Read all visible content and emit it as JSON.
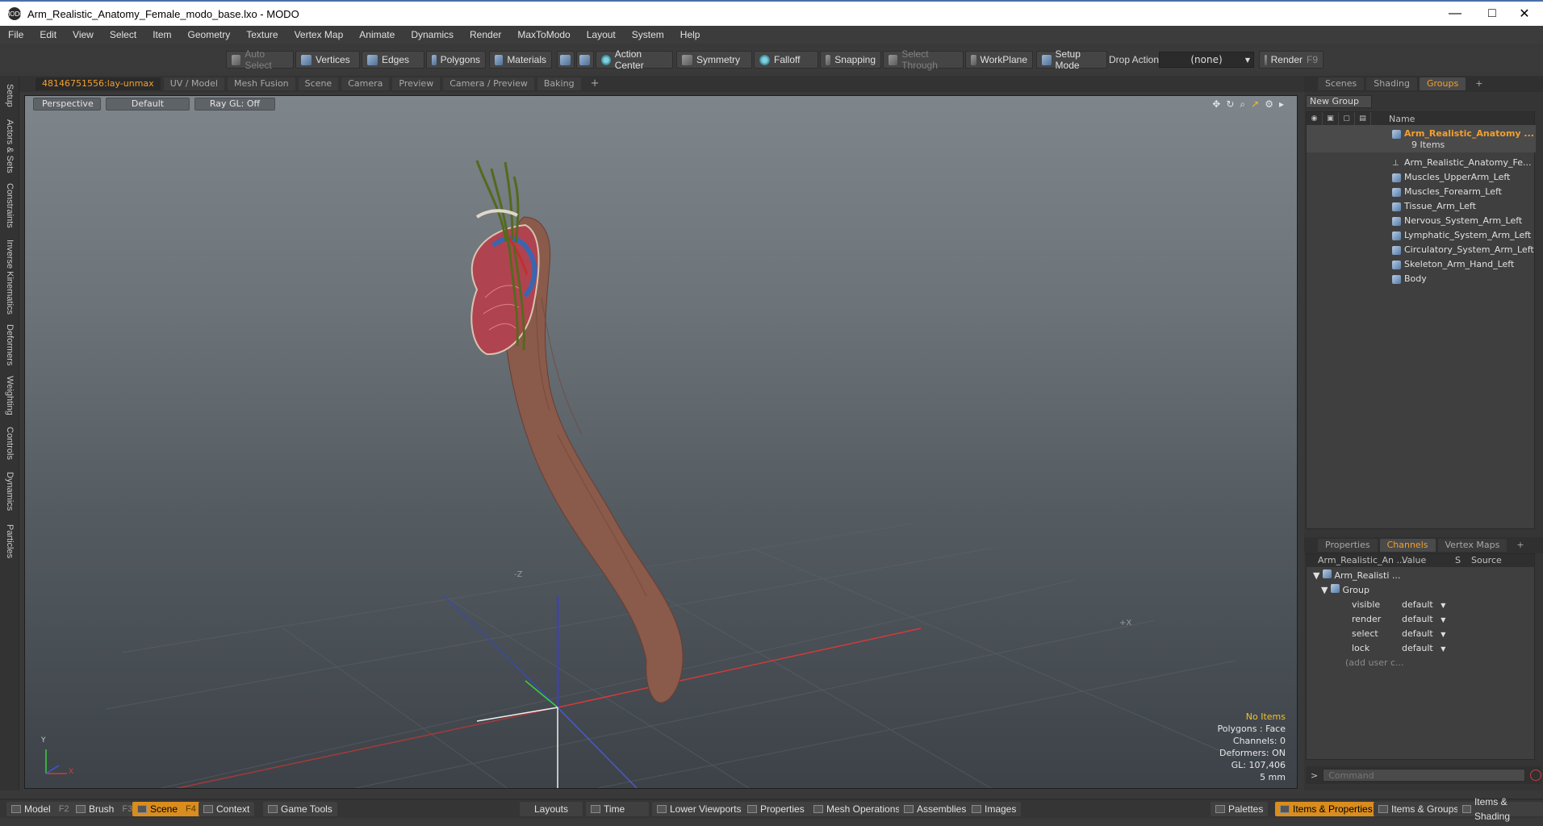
{
  "window": {
    "title": "Arm_Realistic_Anatomy_Female_modo_base.lxo - MODO",
    "app_icon": "MODO"
  },
  "menu": [
    "File",
    "Edit",
    "View",
    "Select",
    "Item",
    "Geometry",
    "Texture",
    "Vertex Map",
    "Animate",
    "Dynamics",
    "Render",
    "MaxToModo",
    "Layout",
    "System",
    "Help"
  ],
  "toolbar": {
    "auto_select": "Auto Select",
    "vertices": "Vertices",
    "edges": "Edges",
    "polygons": "Polygons",
    "materials": "Materials",
    "action_center": "Action Center",
    "symmetry": "Symmetry",
    "falloff": "Falloff",
    "snapping": "Snapping",
    "select_through": "Select Through",
    "workplane": "WorkPlane",
    "setup_mode": "Setup Mode",
    "drop_action": "Drop Action",
    "drop_value": "(none)",
    "render": "Render",
    "render_key": "F9"
  },
  "left_tabs": [
    "Setup",
    "Actors & Sets",
    "Constraints",
    "Inverse Kinematics",
    "Deformers",
    "Weighting",
    "Controls",
    "Dynamics",
    "Particles"
  ],
  "viewport_tabs": [
    "48146751556:lay-unmax",
    "UV / Model",
    "Mesh Fusion",
    "Scene",
    "Camera",
    "Preview",
    "Camera / Preview",
    "Baking"
  ],
  "viewport": {
    "perspective": "Perspective",
    "default": "Default",
    "raygl": "Ray GL: Off",
    "axis_z": "-Z",
    "axis_x": "+X",
    "gizmo_y": "Y",
    "gizmo_x": "X"
  },
  "info": {
    "no_items": "No Items",
    "polygons": "Polygons : Face",
    "channels": "Channels: 0",
    "deformers": "Deformers: ON",
    "gl": "GL: 107,406",
    "scale": "5 mm"
  },
  "right_tabs": [
    "Scenes",
    "Shading",
    "Groups"
  ],
  "groups": {
    "new_group": "New Group",
    "name_header": "Name",
    "root": "Arm_Realistic_Anatomy ...",
    "count": "9 Items",
    "items": [
      "Arm_Realistic_Anatomy_Fe...",
      "Muscles_UpperArm_Left",
      "Muscles_Forearm_Left",
      "Tissue_Arm_Left",
      "Nervous_System_Arm_Left",
      "Lymphatic_System_Arm_Left",
      "Circulatory_System_Arm_Left",
      "Skeleton_Arm_Hand_Left",
      "Body"
    ]
  },
  "channel_tabs": [
    "Properties",
    "Channels",
    "Vertex Maps"
  ],
  "channels": {
    "col_name": "Arm_Realistic_An ...",
    "col_value": "Value",
    "col_s": "S",
    "col_source": "Source",
    "item": "Arm_Realisti ...",
    "group": "Group",
    "rows": [
      {
        "name": "visible",
        "value": "default"
      },
      {
        "name": "render",
        "value": "default"
      },
      {
        "name": "select",
        "value": "default"
      },
      {
        "name": "lock",
        "value": "default"
      }
    ],
    "add": "(add user c..."
  },
  "command": {
    "prompt": ">",
    "placeholder": "Command"
  },
  "bottom": {
    "model": "Model",
    "model_key": "F2",
    "brush": "Brush",
    "brush_key": "F3",
    "scene": "Scene",
    "scene_key": "F4",
    "context": "Context",
    "game_tools": "Game Tools",
    "layouts": "Layouts",
    "time": "Time",
    "lower_viewports": "Lower Viewports",
    "properties": "Properties",
    "mesh_operations": "Mesh Operations",
    "assemblies": "Assemblies",
    "images": "Images",
    "palettes": "Palettes",
    "items_properties": "Items & Properties",
    "items_groups": "Items & Groups",
    "items_shading": "Items & Shading"
  }
}
